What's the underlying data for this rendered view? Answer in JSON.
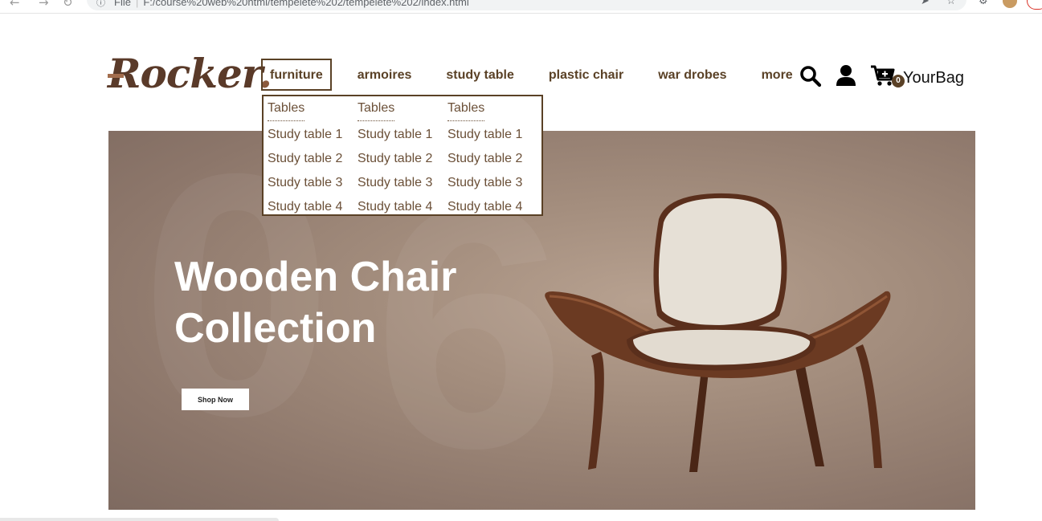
{
  "browser": {
    "info_label": "File",
    "url": "F:/course%20web%20html/tempelete%202/tempelete%202/index.html"
  },
  "header": {
    "logo": "Rocker",
    "logo_dot": ".",
    "nav": [
      "furniture",
      "armoires",
      "study table",
      "plastic chair",
      "war drobes",
      "more"
    ],
    "cart_count": "0",
    "bag_label": "YourBag"
  },
  "dropdown": {
    "columns": [
      {
        "heading": "Tables",
        "items": [
          "Study table 1",
          "Study table 2",
          "Study table 3",
          "Study table 4"
        ]
      },
      {
        "heading": "Tables",
        "items": [
          "Study table 1",
          "Study table 2",
          "Study table 3",
          "Study table 4"
        ]
      },
      {
        "heading": "Tables",
        "items": [
          "Study table 1",
          "Study table 2",
          "Study table 3",
          "Study table 4"
        ]
      }
    ]
  },
  "hero": {
    "title_line1": "Wooden Chair",
    "title_line2": "Collection",
    "button": "Shop Now"
  },
  "colors": {
    "brand": "#5a4126",
    "hero_bg": "#a38d7d",
    "wood": "#6b3a22",
    "fabric": "#e6e0d6"
  },
  "icons": [
    "search-icon",
    "user-icon",
    "cart-plus-icon"
  ]
}
